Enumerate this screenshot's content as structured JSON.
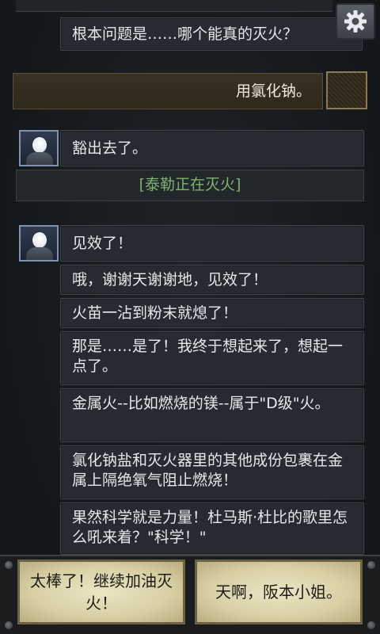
{
  "settings": {
    "icon": "gear-icon"
  },
  "player_choice_made": {
    "text": "用氯化钠。"
  },
  "messages": [
    {
      "text": "根本问题是……哪个能真的灭火？"
    },
    {
      "text": "豁出去了。"
    },
    {
      "text": "见效了！"
    },
    {
      "text": "哦，谢谢天谢谢地，见效了！"
    },
    {
      "text": "火苗一沾到粉末就熄了！"
    },
    {
      "text": "那是……是了！我终于想起来了，想起一点了。"
    },
    {
      "text": "金属火--比如燃烧的镁--属于\"D级\"火。"
    },
    {
      "text": "氯化钠盐和灭火器里的其他成份包裹在金属上隔绝氧气阻止燃烧！"
    },
    {
      "text": "果然科学就是力量！杜马斯·杜比的歌里怎么吼来着？\"科学！\""
    }
  ],
  "status": {
    "text": "[泰勒正在灭火]"
  },
  "choices": [
    {
      "label": "太棒了！继续加油灭火！"
    },
    {
      "label": "天啊，阪本小姐。"
    }
  ],
  "colors": {
    "status_text": "#7fb26a",
    "choice_bg": "#ddd4aa",
    "avatar_border": "#7f93b0"
  }
}
